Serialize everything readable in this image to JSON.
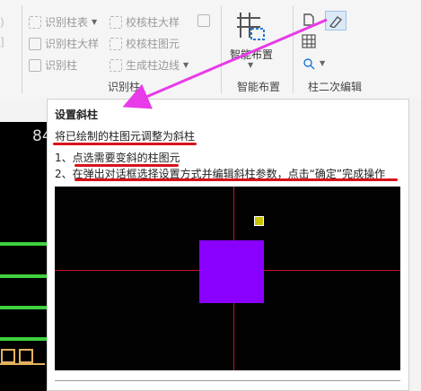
{
  "ribbon": {
    "identify_group": {
      "items": [
        "识别柱表",
        "识别柱大样",
        "识别柱",
        "校核柱大样",
        "校核柱图元",
        "生成柱边线"
      ],
      "label": "识别柱"
    },
    "smart_layout": {
      "button_label": "智能布置",
      "label": "智能布置"
    },
    "secondary_edit": {
      "label": "柱二次编辑"
    }
  },
  "cad": {
    "number_text": "84"
  },
  "tooltip": {
    "title": "设置斜柱",
    "description": "将已绘制的柱图元调整为斜柱",
    "steps": [
      "1、点选需要变斜的柱图元",
      "2、在弹出对话框选择设置方式并编辑斜柱参数，点击“确定”完成操作"
    ]
  },
  "colors": {
    "highlight_arrow": "#e83ae8",
    "annotation_underline": "#d8121a",
    "column_fill": "#8a00ff",
    "axis_line": "#c8102e",
    "handle": "#c7c300"
  }
}
